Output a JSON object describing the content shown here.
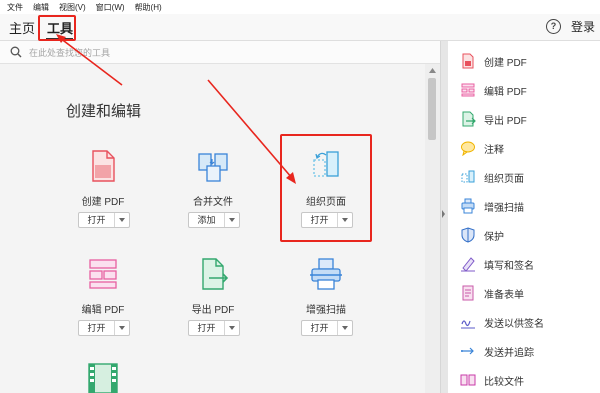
{
  "menu": [
    "文件",
    "编辑",
    "视图(V)",
    "窗口(W)",
    "帮助(H)"
  ],
  "nav": {
    "home": "主页",
    "tools": "工具",
    "help": "?",
    "login": "登录"
  },
  "search": {
    "placeholder": "在此处查找您的工具"
  },
  "section": {
    "title": "创建和编辑"
  },
  "tools": [
    {
      "label": "创建 PDF",
      "button": "打开",
      "icon": "create-pdf-icon"
    },
    {
      "label": "合并文件",
      "button": "添加",
      "icon": "combine-files-icon"
    },
    {
      "label": "组织页面",
      "button": "打开",
      "icon": "organize-pages-icon"
    },
    {
      "label": "编辑 PDF",
      "button": "打开",
      "icon": "edit-pdf-icon"
    },
    {
      "label": "导出 PDF",
      "button": "打开",
      "icon": "export-pdf-icon"
    },
    {
      "label": "增强扫描",
      "button": "打开",
      "icon": "enhance-scan-icon"
    }
  ],
  "right_panel": [
    {
      "label": "创建 PDF",
      "icon": "create-pdf-icon",
      "color": "#e8515d"
    },
    {
      "label": "编辑 PDF",
      "icon": "edit-pdf-icon",
      "color": "#e85fa0"
    },
    {
      "label": "导出 PDF",
      "icon": "export-pdf-icon",
      "color": "#33a86e"
    },
    {
      "label": "注释",
      "icon": "comment-icon",
      "color": "#f0b400"
    },
    {
      "label": "组织页面",
      "icon": "organize-pages-icon",
      "color": "#3aa0d8"
    },
    {
      "label": "增强扫描",
      "icon": "enhance-scan-icon",
      "color": "#3a84d8"
    },
    {
      "label": "保护",
      "icon": "shield-icon",
      "color": "#3470c8"
    },
    {
      "label": "填写和签名",
      "icon": "sign-pen-icon",
      "color": "#7f5ac8"
    },
    {
      "label": "准备表单",
      "icon": "form-icon",
      "color": "#c85aa8"
    },
    {
      "label": "发送以供签名",
      "icon": "send-sign-icon",
      "color": "#5a5ac8"
    },
    {
      "label": "发送并追踪",
      "icon": "send-track-icon",
      "color": "#3a84d8"
    },
    {
      "label": "比较文件",
      "icon": "compare-files-icon",
      "color": "#c83aa8"
    }
  ],
  "colors": {
    "highlight": "#e8261e",
    "accent": "#1473e6"
  }
}
